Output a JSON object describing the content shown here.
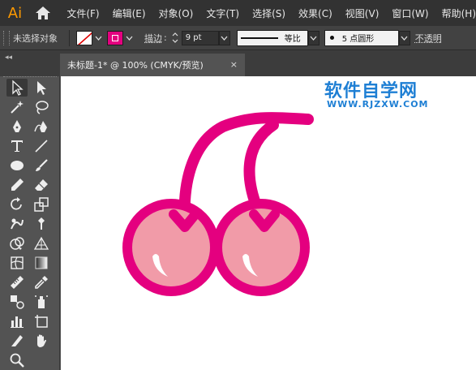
{
  "app": {
    "logo": "Ai"
  },
  "menu": [
    "文件(F)",
    "编辑(E)",
    "对象(O)",
    "文字(T)",
    "选择(S)",
    "效果(C)",
    "视图(V)",
    "窗口(W)",
    "帮助(H)"
  ],
  "control_bar": {
    "selection_status": "未选择对象",
    "stroke_label": "描边",
    "stroke_weight": "9 pt",
    "profile_label": "等比",
    "brush_label": "5 点圆形",
    "opacity_label": "不透明"
  },
  "document": {
    "tab_title": "未标题-1* @ 100% (CMYK/预览)",
    "close_glyph": "×"
  },
  "panel": {
    "collapse_glyph": "◂◂"
  },
  "watermark": {
    "title": "软件自学网",
    "url": "WWW.RJZXW.COM"
  },
  "colors": {
    "menubar_bg": "#323232",
    "controlbar_bg": "#424242",
    "toolbar_bg": "#535353",
    "stroke_magenta": "#e4007f",
    "cherry_fill": "#f19ba8",
    "highlight": "#ffffff",
    "watermark_blue": "#1e7fd4",
    "app_orange": "#ff9a00"
  },
  "tools": [
    "selection-tool",
    "direct-selection-tool",
    "magic-wand-tool",
    "lasso-tool",
    "pen-tool",
    "curvature-tool",
    "type-tool",
    "line-segment-tool",
    "ellipse-tool",
    "paintbrush-tool",
    "pencil-tool",
    "eraser-tool",
    "rotate-tool",
    "scale-tool",
    "warp-tool",
    "free-transform-tool",
    "shape-builder-tool",
    "perspective-grid-tool",
    "mesh-tool",
    "gradient-tool",
    "measure-tool",
    "eyedropper-tool",
    "blend-tool",
    "symbol-sprayer-tool",
    "column-graph-tool",
    "artboard-tool",
    "slice-tool",
    "hand-tool",
    "zoom-tool"
  ]
}
